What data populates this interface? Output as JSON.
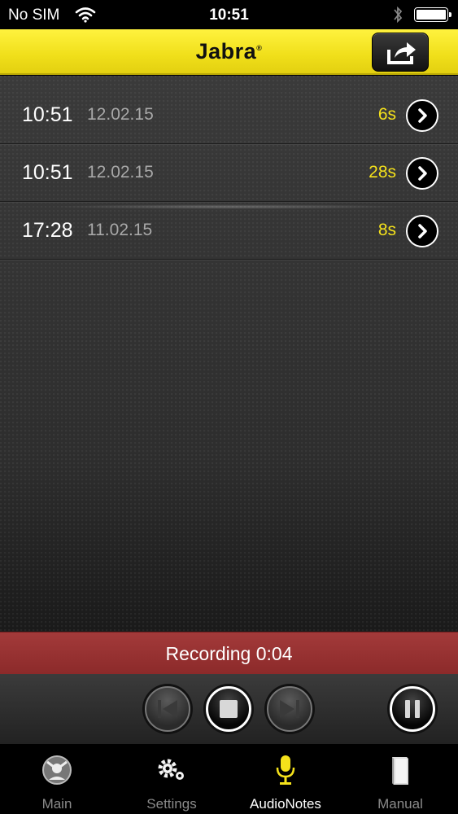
{
  "status_bar": {
    "carrier": "No SIM",
    "time": "10:51"
  },
  "header": {
    "logo": "Jabra",
    "logo_mark": "®"
  },
  "recordings": [
    {
      "time": "10:51",
      "date": "12.02.15",
      "duration": "6s"
    },
    {
      "time": "10:51",
      "date": "12.02.15",
      "duration": "28s"
    },
    {
      "time": "17:28",
      "date": "11.02.15",
      "duration": "8s"
    }
  ],
  "recording_status": "Recording 0:04",
  "tabs": [
    {
      "label": "Main",
      "icon": "main-icon"
    },
    {
      "label": "Settings",
      "icon": "gears-icon"
    },
    {
      "label": "AudioNotes",
      "icon": "microphone-icon"
    },
    {
      "label": "Manual",
      "icon": "book-icon"
    }
  ],
  "colors": {
    "accent": "#f0df1a",
    "duration": "#f5e21b",
    "recording_bar": "#9a3232"
  }
}
